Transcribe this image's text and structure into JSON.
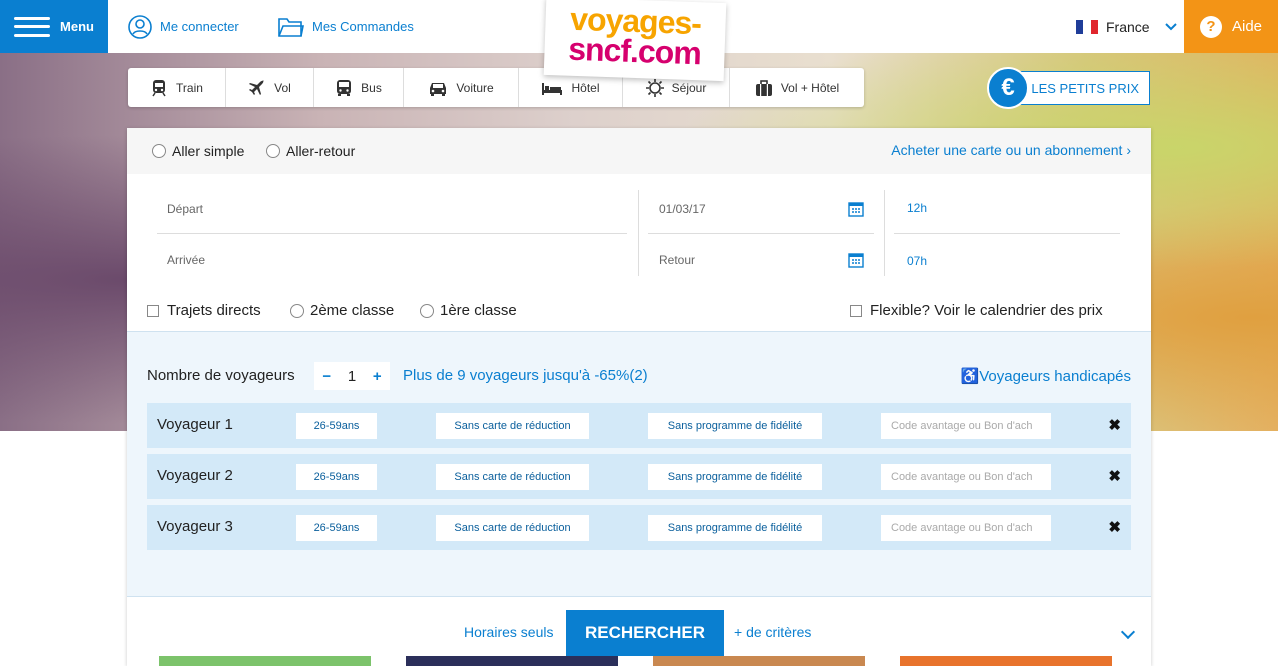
{
  "header": {
    "menu_label": "Menu",
    "login_label": "Me connecter",
    "orders_label": "Mes Commandes",
    "logo_line1": "voyages-",
    "logo_line2": "sncf.com",
    "country_label": "France",
    "help_label": "Aide",
    "colors": {
      "brand_blue": "#0a7fd0",
      "help_orange": "#f39416"
    }
  },
  "modes": [
    {
      "label": "Train",
      "icon": "train-icon"
    },
    {
      "label": "Vol",
      "icon": "plane-icon"
    },
    {
      "label": "Bus",
      "icon": "bus-icon"
    },
    {
      "label": "Voiture",
      "icon": "car-icon"
    },
    {
      "label": "Hôtel",
      "icon": "bed-icon"
    },
    {
      "label": "Séjour",
      "icon": "sun-icon"
    },
    {
      "label": "Vol + Hôtel",
      "icon": "suitcase-icon"
    }
  ],
  "petits_prix": {
    "icon_text": "€",
    "label": "LES PETITS PRIX"
  },
  "trip": {
    "one_way": "Aller simple",
    "round_trip": "Aller-retour",
    "card_link": "Acheter une carte ou un abonnement"
  },
  "form": {
    "depart_placeholder": "Départ",
    "arrivee_placeholder": "Arrivée",
    "date_aller": "01/03/17",
    "date_retour_placeholder": "Retour",
    "time_aller": "12h",
    "time_retour": "07h"
  },
  "options": {
    "direct": "Trajets directs",
    "second_class": "2ème classe",
    "first_class": "1ère classe",
    "flexible": "Flexible? Voir le calendrier des prix"
  },
  "travelers": {
    "count_label": "Nombre de voyageurs",
    "minus": "−",
    "count": "1",
    "plus": "+",
    "group_link": "Plus de 9 voyageurs jusqu'à -65%(2)",
    "handicap_link": "Voyageurs handicapés",
    "rows": [
      {
        "name": "Voyageur 1",
        "age": "26-59ans",
        "card": "Sans carte de réduction",
        "loyalty": "Sans programme de fidélité",
        "code_placeholder": "Code avantage ou Bon d'ach",
        "remove": "✖"
      },
      {
        "name": "Voyageur 2",
        "age": "26-59ans",
        "card": "Sans carte de réduction",
        "loyalty": "Sans programme de fidélité",
        "code_placeholder": "Code avantage ou Bon d'ach",
        "remove": "✖"
      },
      {
        "name": "Voyageur 3",
        "age": "26-59ans",
        "card": "Sans carte de réduction",
        "loyalty": "Sans programme de fidélité",
        "code_placeholder": "Code avantage ou Bon d'ach",
        "remove": "✖"
      }
    ]
  },
  "actions": {
    "horaires": "Horaires seuls",
    "search": "RECHERCHER",
    "more_criteria": "+ de critères"
  }
}
